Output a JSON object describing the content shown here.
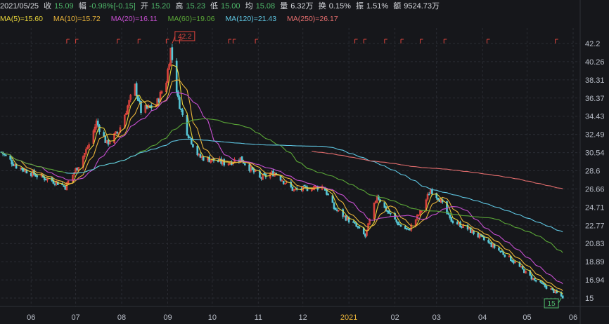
{
  "header": {
    "date": "2021/05/25",
    "close_label": "收",
    "close": "15.09",
    "change_label": "幅",
    "change": "-0.98%[-0.15]",
    "open_label": "开",
    "open": "15.20",
    "high_label": "高",
    "high": "15.23",
    "low_label": "低",
    "low": "15.00",
    "avg_label": "均",
    "avg": "15.08",
    "volume_label": "量",
    "volume": "6.32万",
    "turnover_label": "换",
    "turnover": "0.15%",
    "amplitude_label": "振",
    "amplitude": "1.51%",
    "amount_label": "额",
    "amount": "9524.73万"
  },
  "ma_legend": [
    {
      "label": "MA(5)=15.60",
      "color": "#e6d33a"
    },
    {
      "label": "MA(10)=15.72",
      "color": "#e8b33a"
    },
    {
      "label": "MA(20)=16.11",
      "color": "#c64fd0"
    },
    {
      "label": "MA(60)=19.06",
      "color": "#5aa637"
    },
    {
      "label": "MA(120)=21.43",
      "color": "#5fc7e3"
    },
    {
      "label": "MA(250)=26.17",
      "color": "#e36d6d"
    }
  ],
  "colors": {
    "up": "#e0453e",
    "down": "#57c7d6",
    "grid": "#2a2c33",
    "axis_text": "#b9bec8",
    "ma5": "#e6d33a",
    "ma10": "#e8b33a",
    "ma20": "#c64fd0",
    "ma60": "#5aa637",
    "ma120": "#5fc7e3",
    "ma250": "#e36d6d",
    "high_marker": "#e0453e",
    "low_marker": "#4fb86a"
  },
  "chart_data": {
    "type": "candlestick",
    "y_ticks": [
      "42.2",
      "40.26",
      "38.31",
      "36.37",
      "34.43",
      "32.49",
      "30.54",
      "28.6",
      "26.66",
      "24.71",
      "22.77",
      "20.83",
      "18.89",
      "16.94",
      "15"
    ],
    "ylim": [
      15,
      42.2
    ],
    "x_ticks": [
      "06",
      "07",
      "08",
      "09",
      "10",
      "11",
      "12",
      "2021",
      "02",
      "03",
      "04",
      "05",
      "06"
    ],
    "high_marker": {
      "label": "42.2",
      "value": 42.2,
      "date_index": 58
    },
    "low_marker": {
      "label": "15",
      "value": 15.0,
      "date_index": 232
    },
    "date_axis": [
      "2020-05-12",
      "2021-06-01"
    ],
    "x_tick_dates": [
      "2020-06-01",
      "2020-07-01",
      "2020-08-01",
      "2020-09-01",
      "2020-10-01",
      "2020-11-01",
      "2020-12-01",
      "2021-01-01",
      "2021-02-01",
      "2021-03-01",
      "2021-04-01",
      "2021-05-01",
      "2021-06-01"
    ],
    "price_anchors": [
      [
        "2020-05-12",
        30.6
      ],
      [
        "2020-05-22",
        29.1
      ],
      [
        "2020-06-05",
        28.1
      ],
      [
        "2020-06-18",
        27.4
      ],
      [
        "2020-06-24",
        26.9
      ],
      [
        "2020-07-03",
        29.2
      ],
      [
        "2020-07-10",
        31.4
      ],
      [
        "2020-07-15",
        33.8
      ],
      [
        "2020-07-22",
        31.5
      ],
      [
        "2020-07-30",
        32.8
      ],
      [
        "2020-08-05",
        35.5
      ],
      [
        "2020-08-10",
        37.6
      ],
      [
        "2020-08-14",
        35.0
      ],
      [
        "2020-08-24",
        35.6
      ],
      [
        "2020-08-31",
        38.2
      ],
      [
        "2020-09-03",
        41.6
      ],
      [
        "2020-09-08",
        36.2
      ],
      [
        "2020-09-14",
        32.8
      ],
      [
        "2020-09-22",
        30.1
      ],
      [
        "2020-10-10",
        29.4
      ],
      [
        "2020-10-20",
        29.9
      ],
      [
        "2020-11-02",
        27.8
      ],
      [
        "2020-11-12",
        28.4
      ],
      [
        "2020-11-25",
        26.5
      ],
      [
        "2020-12-07",
        26.8
      ],
      [
        "2020-12-15",
        26.9
      ],
      [
        "2020-12-22",
        24.6
      ],
      [
        "2021-01-05",
        22.8
      ],
      [
        "2021-01-12",
        21.6
      ],
      [
        "2021-01-20",
        26.0
      ],
      [
        "2021-01-25",
        24.6
      ],
      [
        "2021-02-04",
        22.8
      ],
      [
        "2021-02-10",
        22.2
      ],
      [
        "2021-02-19",
        24.4
      ],
      [
        "2021-02-25",
        26.6
      ],
      [
        "2021-03-03",
        25.6
      ],
      [
        "2021-03-10",
        23.4
      ],
      [
        "2021-03-22",
        22.4
      ],
      [
        "2021-04-05",
        20.9
      ],
      [
        "2021-04-19",
        19.3
      ],
      [
        "2021-05-06",
        16.9
      ],
      [
        "2021-05-17",
        15.9
      ],
      [
        "2021-05-25",
        15.1
      ]
    ]
  }
}
